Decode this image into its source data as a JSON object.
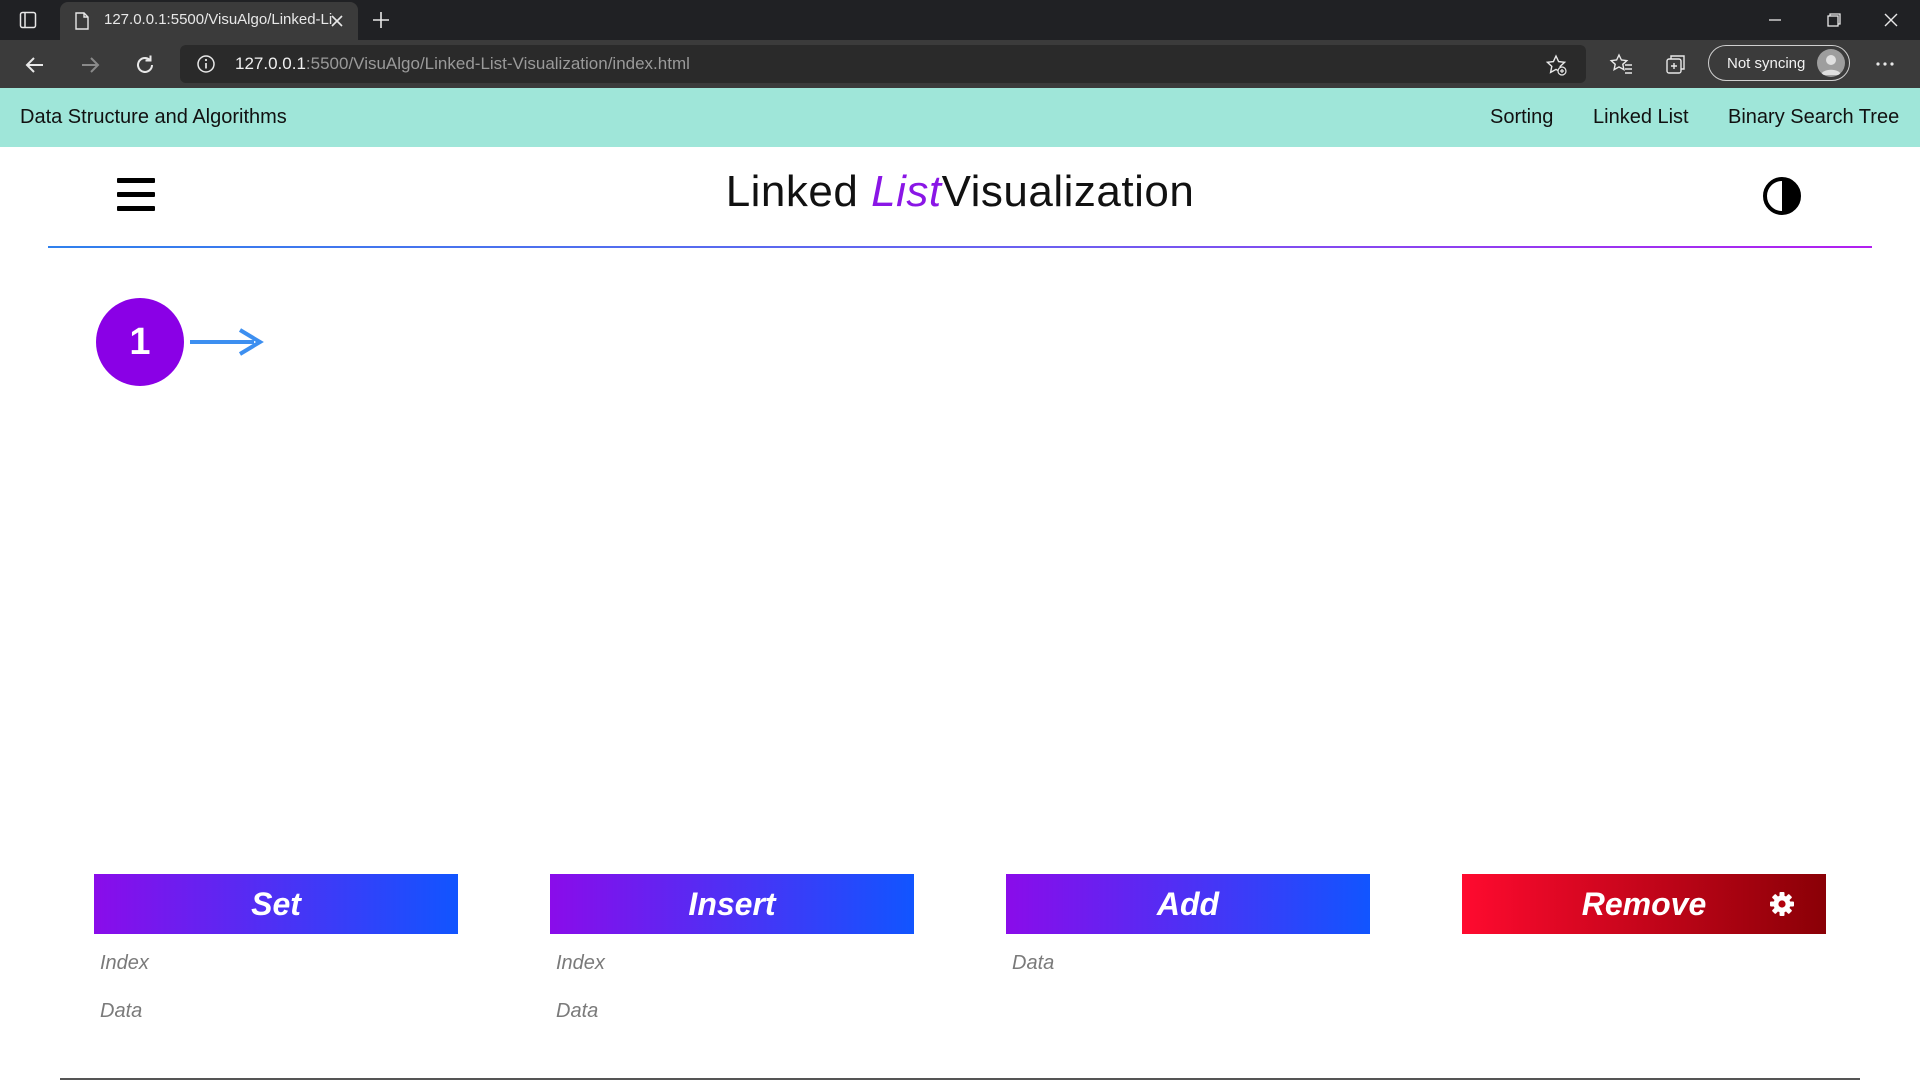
{
  "browser": {
    "tab_title": "127.0.0.1:5500/VisuAlgo/Linked-List-Visualization/index.html",
    "url_host": "127.0.0.1",
    "url_rest": ":5500/VisuAlgo/Linked-List-Visualization/index.html",
    "sync_label": "Not syncing"
  },
  "navbar": {
    "brand": "Data Structure and Algorithms",
    "links": [
      "Sorting",
      "Linked List",
      "Binary Search Tree"
    ]
  },
  "header": {
    "title_part1": "Linked",
    "title_accent": "List",
    "title_part2": "Visualization"
  },
  "linked_list": {
    "nodes": [
      "1"
    ]
  },
  "controls": {
    "set": {
      "label": "Set",
      "index_placeholder": "Index",
      "data_placeholder": "Data"
    },
    "insert": {
      "label": "Insert",
      "index_placeholder": "Index",
      "data_placeholder": "Data"
    },
    "add": {
      "label": "Add",
      "data_placeholder": "Data"
    },
    "remove": {
      "label": "Remove"
    }
  },
  "colors": {
    "navbar_bg": "#9fe6d9",
    "accent_purple": "#8a16e6",
    "button_blue_start": "#8a0cea",
    "button_blue_end": "#1155ff",
    "button_red_start": "#ff0a2f",
    "button_red_end": "#8a0006",
    "arrow_blue": "#3d8ff0"
  }
}
